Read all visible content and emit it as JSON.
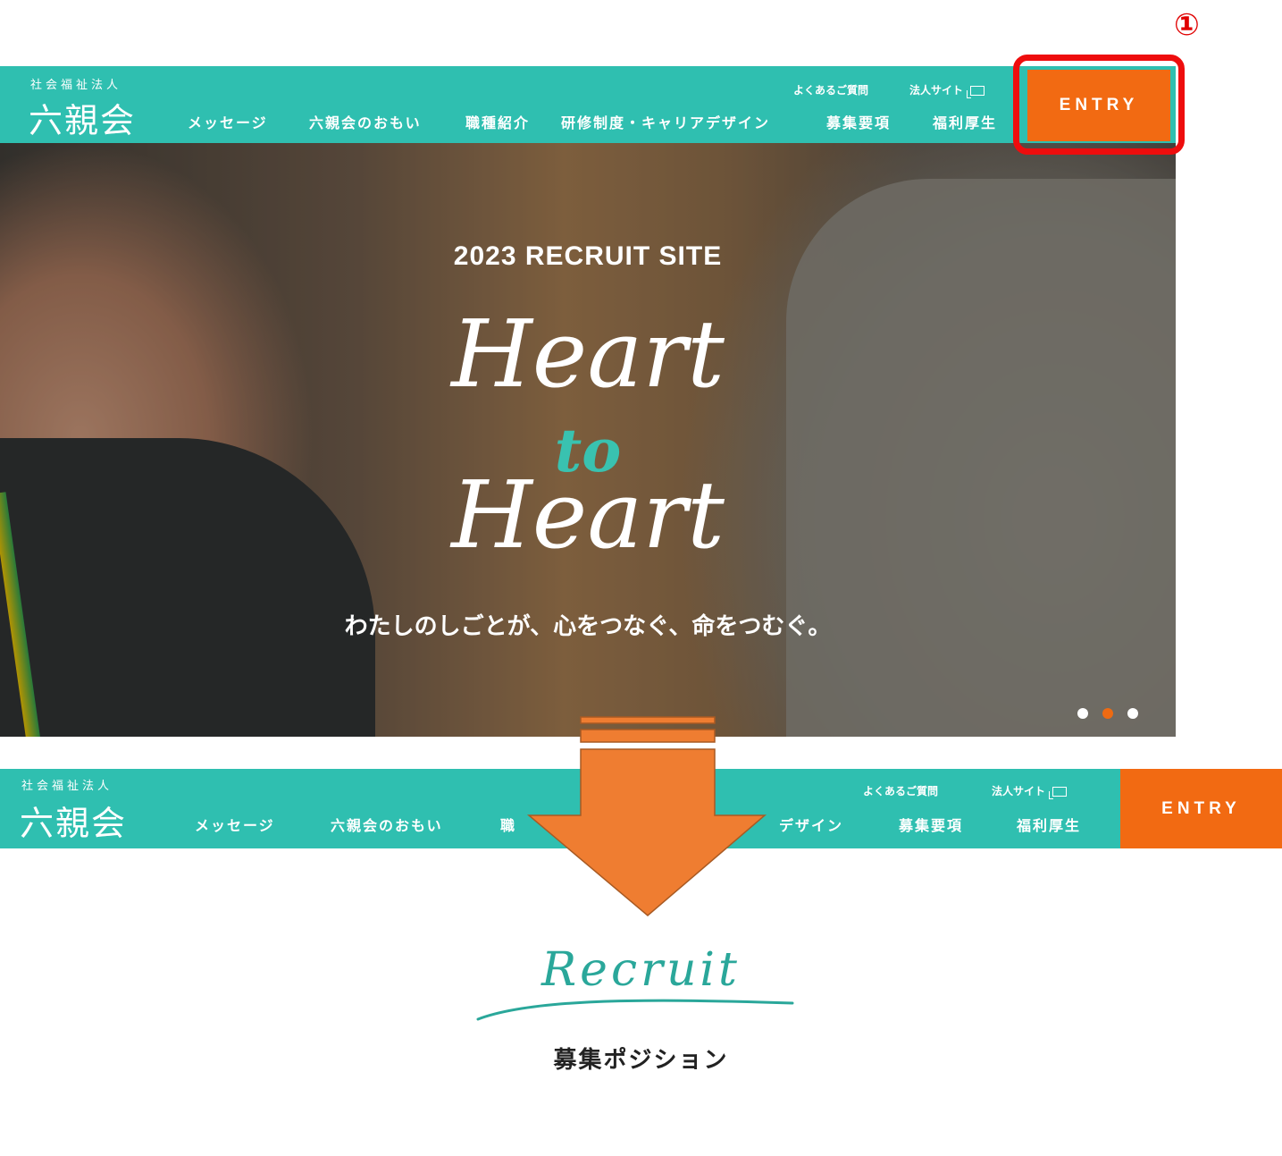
{
  "annotation": {
    "step_number": "①",
    "highlight_color": "#ee0d0d",
    "arrow_color": "#ef7d31"
  },
  "brand": {
    "teal": "#2fbfb0",
    "orange": "#f26a12"
  },
  "header": {
    "logo_sub": "社会福祉法人",
    "logo_main": "六親会",
    "utility": {
      "faq": "よくあるご質問",
      "corp_site": "法人サイト"
    },
    "nav": [
      "メッセージ",
      "六親会のおもい",
      "職種紹介",
      "研修制度・キャリアデザイン",
      "募集要項",
      "福利厚生"
    ],
    "entry": "ENTRY"
  },
  "hero": {
    "subtitle": "2023 RECRUIT SITE",
    "heart1": "Heart",
    "to": "to",
    "heart2": "Heart",
    "tagline": "わたしのしごとが、心をつなぐ、命をつむぐ。",
    "slides_total": 3,
    "slide_active": 2
  },
  "header2": {
    "nav_visible": [
      "メッセージ",
      "六親会のおもい",
      "職",
      "デザイン",
      "募集要項",
      "福利厚生"
    ]
  },
  "recruit_section": {
    "title": "Recruit",
    "subtitle": "募集ポジション"
  }
}
